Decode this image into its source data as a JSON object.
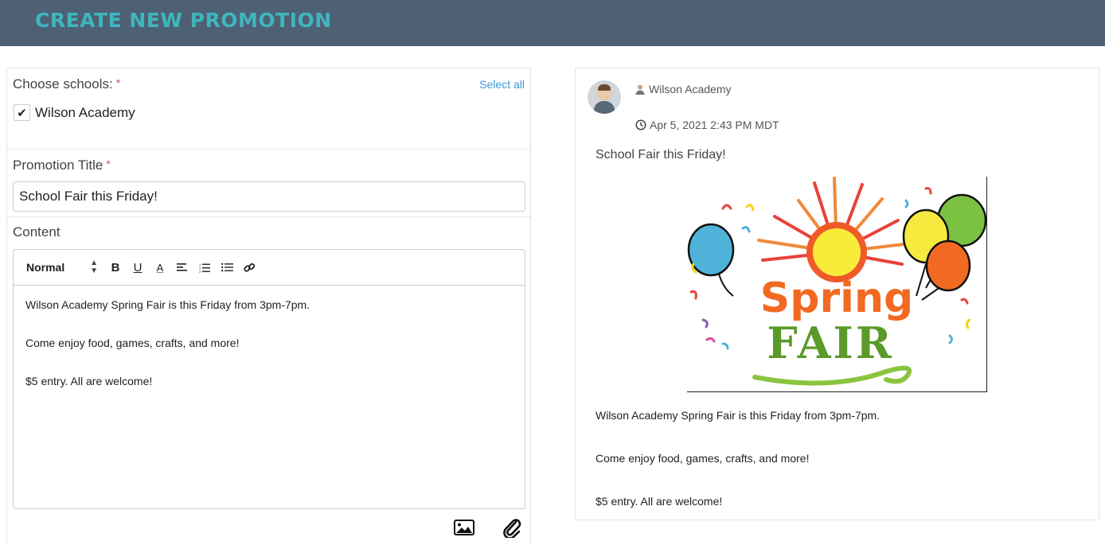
{
  "header": {
    "title": "CREATE NEW PROMOTION"
  },
  "schools": {
    "label": "Choose schools:",
    "required_mark": "*",
    "select_all": "Select all",
    "items": [
      {
        "label": "Wilson Academy",
        "checked": true
      }
    ]
  },
  "promotion_title": {
    "label": "Promotion Title",
    "required_mark": "*",
    "value": "School Fair this Friday!"
  },
  "content": {
    "label": "Content",
    "toolbar": {
      "format_select": "Normal",
      "bold": "B",
      "underline": "U",
      "color": "A"
    },
    "paragraphs": [
      "Wilson Academy Spring Fair is this Friday from 3pm-7pm.",
      "Come enjoy food, games, crafts, and more!",
      "$5 entry. All are welcome!"
    ]
  },
  "preview": {
    "author": "Wilson Academy",
    "date": "Apr 5, 2021 2:43 PM MDT",
    "title": "School Fair this Friday!",
    "image_text": {
      "line1": "Spring",
      "line2": "FAIR"
    },
    "paragraphs": [
      "Wilson Academy Spring Fair is this Friday from 3pm-7pm.",
      "Come enjoy food, games, crafts, and more!",
      "$5 entry. All are welcome!"
    ]
  },
  "colors": {
    "header_bg": "#4e6174",
    "header_text": "#3fb6bd",
    "link": "#3a9ad9",
    "required": "#d9534f"
  },
  "icons": [
    "checkmark-icon",
    "align-left-icon",
    "ordered-list-icon",
    "bullet-list-icon",
    "link-icon",
    "image-icon",
    "paperclip-icon",
    "user-icon",
    "clock-icon"
  ]
}
